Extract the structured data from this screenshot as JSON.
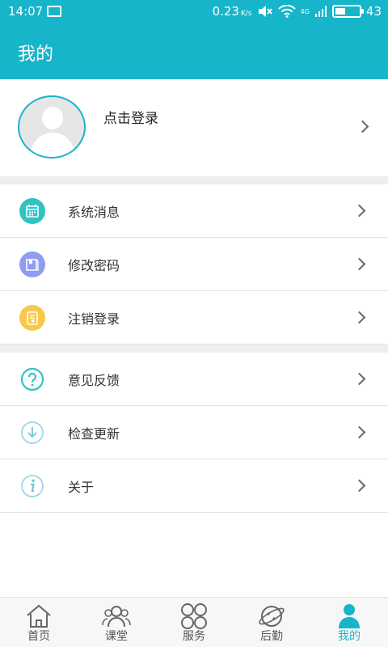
{
  "status": {
    "time": "14:07",
    "speed": "0.23",
    "speed_unit": "K/s",
    "network": "4G",
    "battery": "43",
    "battery_level": 0.43
  },
  "header": {
    "title": "我的"
  },
  "profile": {
    "login_label": "点击登录"
  },
  "menu_group_1": [
    {
      "label": "系统消息",
      "icon": "calendar-icon",
      "color": "#2ec4c2"
    },
    {
      "label": "修改密码",
      "icon": "book-icon",
      "color": "#8f9cf0"
    },
    {
      "label": "注销登录",
      "icon": "document-icon",
      "color": "#f7c94a"
    }
  ],
  "menu_group_2": [
    {
      "label": "意见反馈",
      "icon": "question-icon",
      "color": "#2ec4c2"
    },
    {
      "label": "检查更新",
      "icon": "download-icon",
      "color": "#76c4d8"
    },
    {
      "label": "关于",
      "icon": "info-icon",
      "color": "#76c4d8"
    }
  ],
  "tabs": [
    {
      "label": "首页",
      "icon": "home-icon"
    },
    {
      "label": "课堂",
      "icon": "people-icon"
    },
    {
      "label": "服务",
      "icon": "grid-icon"
    },
    {
      "label": "后勤",
      "icon": "planet-icon"
    },
    {
      "label": "我的",
      "icon": "person-icon",
      "active": true
    }
  ],
  "colors": {
    "accent": "#17b5ca",
    "divider": "#eeeeee"
  }
}
